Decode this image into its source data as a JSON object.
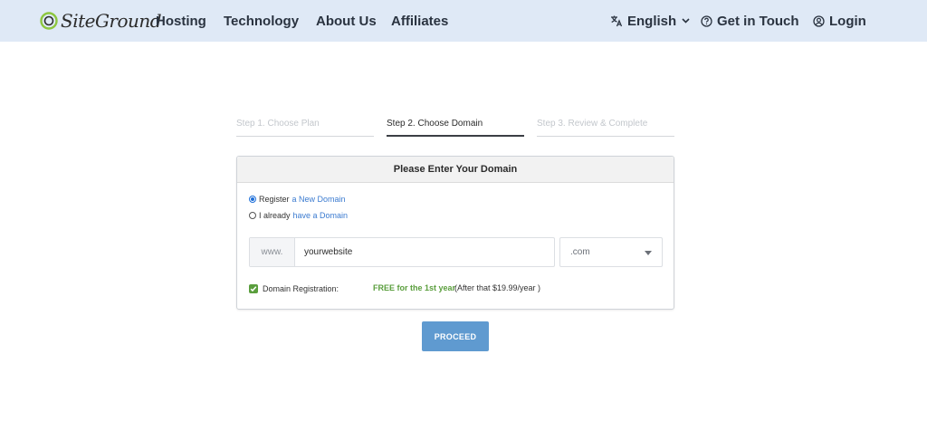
{
  "header": {
    "logo_text": "SiteGround",
    "nav": {
      "hosting": "Hosting",
      "technology": "Technology",
      "about": "About Us",
      "affiliates": "Affiliates",
      "language": "English",
      "contact": "Get in Touch",
      "login": "Login"
    }
  },
  "steps": [
    {
      "label": "Step 1. Choose Plan",
      "state": "inactive"
    },
    {
      "label": "Step 2. Choose Domain",
      "state": "active"
    },
    {
      "label": "Step 3. Review & Complete",
      "state": "inactive"
    }
  ],
  "card": {
    "title": "Please Enter Your Domain",
    "register_option": {
      "prefix": "Register",
      "link": "a New Domain",
      "selected": true
    },
    "existing_option": {
      "prefix": "I already",
      "link": "have a Domain",
      "selected": false
    },
    "www_prefix": "www.",
    "domain_value": "yourwebsite",
    "tld_selected": ".com",
    "registration_label": "Domain Registration:",
    "registration_checked": true,
    "free_text": "FREE for the 1st year",
    "after_text": "(After that $19.99/year )"
  },
  "proceed_label": "PROCEED",
  "colors": {
    "header_bg": "#dfe9f6",
    "link": "#3b7bd0",
    "green": "#5a9e3d",
    "button": "#5f9ad0"
  }
}
